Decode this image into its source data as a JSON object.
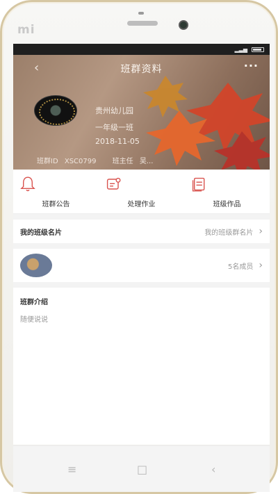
{
  "device": {
    "brand": "mi"
  },
  "header": {
    "title": "班群资料",
    "back_icon": "chevron-left-icon",
    "more_icon": "ellipsis-icon"
  },
  "profile": {
    "school": "贵州幼儿园",
    "class_name": "一年级一班",
    "date": "2018-11-05",
    "group_id_label": "班群ID",
    "group_id": "XSC0799",
    "teacher_label": "班主任",
    "teacher": "吴..."
  },
  "actions": [
    {
      "label": "班群公告",
      "icon": "bell-icon"
    },
    {
      "label": "处理作业",
      "icon": "homework-icon"
    },
    {
      "label": "班级作品",
      "icon": "documents-icon"
    }
  ],
  "class_card": {
    "label": "我的班级名片",
    "value": "我的班级群名片"
  },
  "members": {
    "count_text": "5名成员"
  },
  "intro": {
    "title": "班群介绍",
    "text": "随便说说"
  },
  "navbar": {
    "menu_icon": "menu-icon",
    "home_icon": "home-icon",
    "back_icon": "back-icon"
  }
}
